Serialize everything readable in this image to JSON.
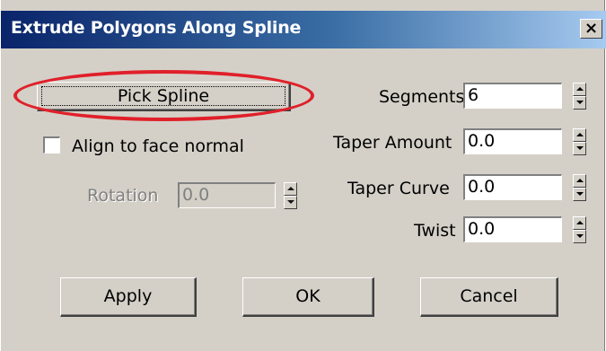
{
  "window": {
    "title": "Extrude Polygons Along Spline",
    "close_glyph": "×"
  },
  "pick_spline": {
    "label": "Pick Spline"
  },
  "align": {
    "label": "Align to face normal",
    "checked": false
  },
  "rotation": {
    "label": "Rotation",
    "value": "0.0",
    "enabled": false
  },
  "params": {
    "segments": {
      "label": "Segments",
      "value": "6"
    },
    "taper_amount": {
      "label": "Taper Amount",
      "value": "0.0"
    },
    "taper_curve": {
      "label": "Taper Curve",
      "value": "0.0"
    },
    "twist": {
      "label": "Twist",
      "value": "0.0"
    }
  },
  "buttons": {
    "apply": "Apply",
    "ok": "OK",
    "cancel": "Cancel"
  },
  "colors": {
    "dialog_face": "#d4d0c8",
    "titlebar_start": "#0a246a",
    "titlebar_end": "#a6caf0",
    "highlight_ellipse": "#e0202a"
  },
  "icons": {
    "close": "close-icon",
    "spinner_up": "arrow-up-icon",
    "spinner_down": "arrow-down-icon"
  }
}
